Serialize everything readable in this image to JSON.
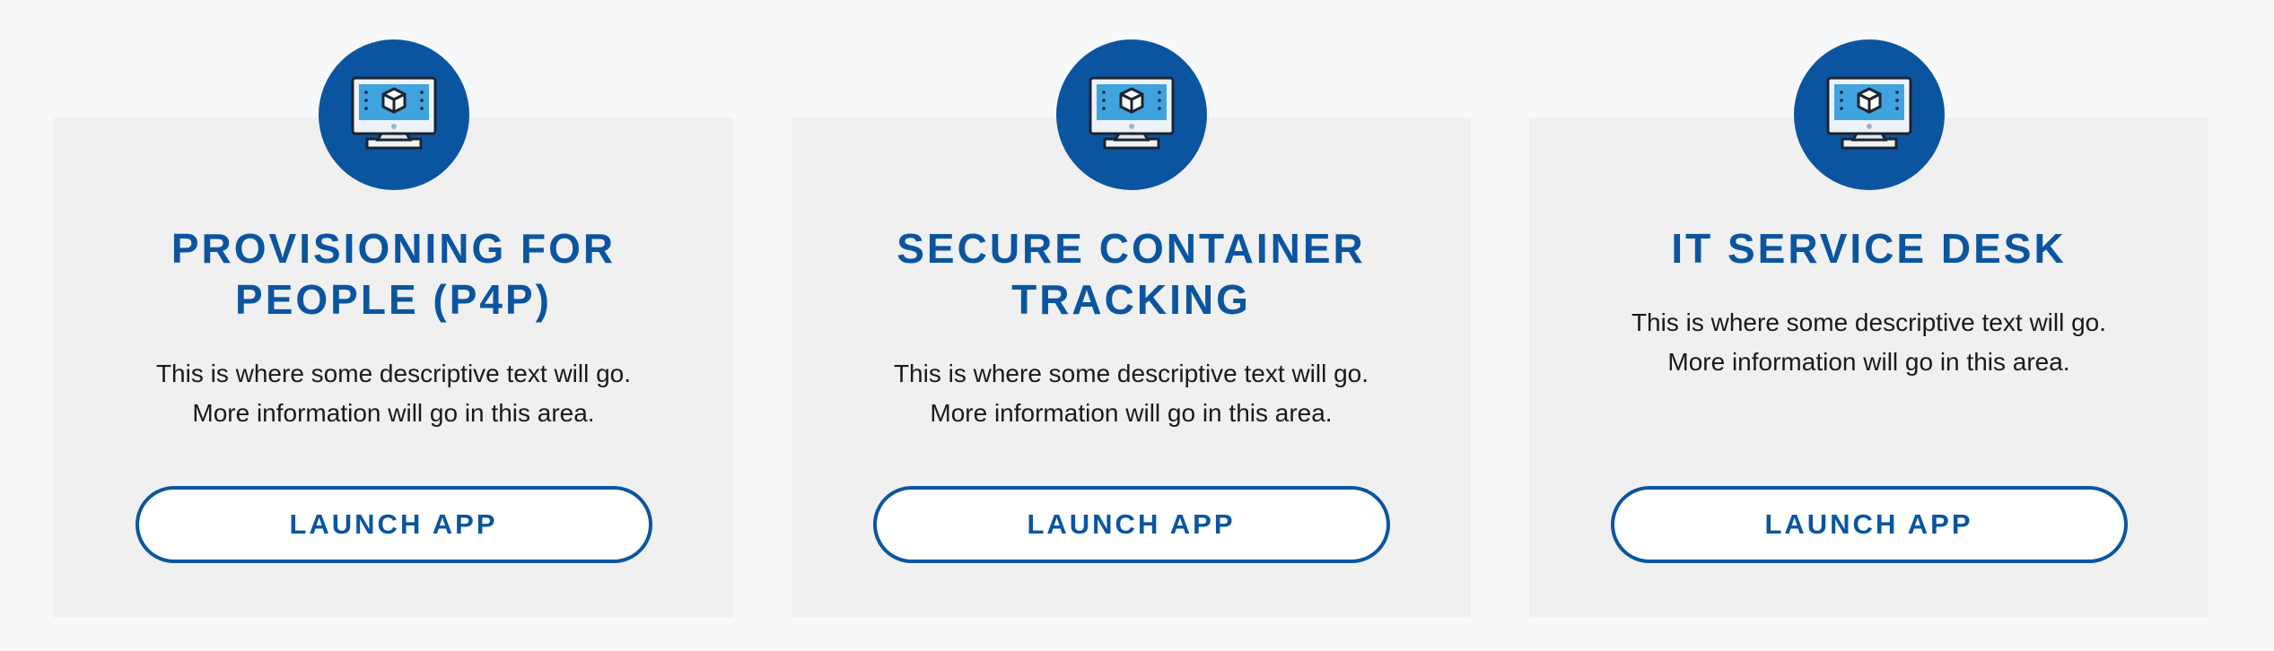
{
  "colors": {
    "accent": "#0b55a0",
    "card_background": "#f0f0f0",
    "page_background": "#f7f8fa",
    "screen_blue": "#3ea3df"
  },
  "cards": [
    {
      "icon": "monitor-cube-icon",
      "title": "PROVISIONING FOR PEOPLE (P4P)",
      "description_line1": "This is where some descriptive text will go.",
      "description_line2": "More information will go in this area.",
      "button_label": "LAUNCH APP"
    },
    {
      "icon": "monitor-cube-icon",
      "title": "SECURE CONTAINER TRACKING",
      "description_line1": "This is where some descriptive text will go.",
      "description_line2": "More information will go in this area.",
      "button_label": "LAUNCH APP"
    },
    {
      "icon": "monitor-cube-icon",
      "title": "IT SERVICE DESK",
      "description_line1": "This is where some descriptive text will go.",
      "description_line2": "More information will go in this area.",
      "button_label": "LAUNCH APP"
    }
  ]
}
